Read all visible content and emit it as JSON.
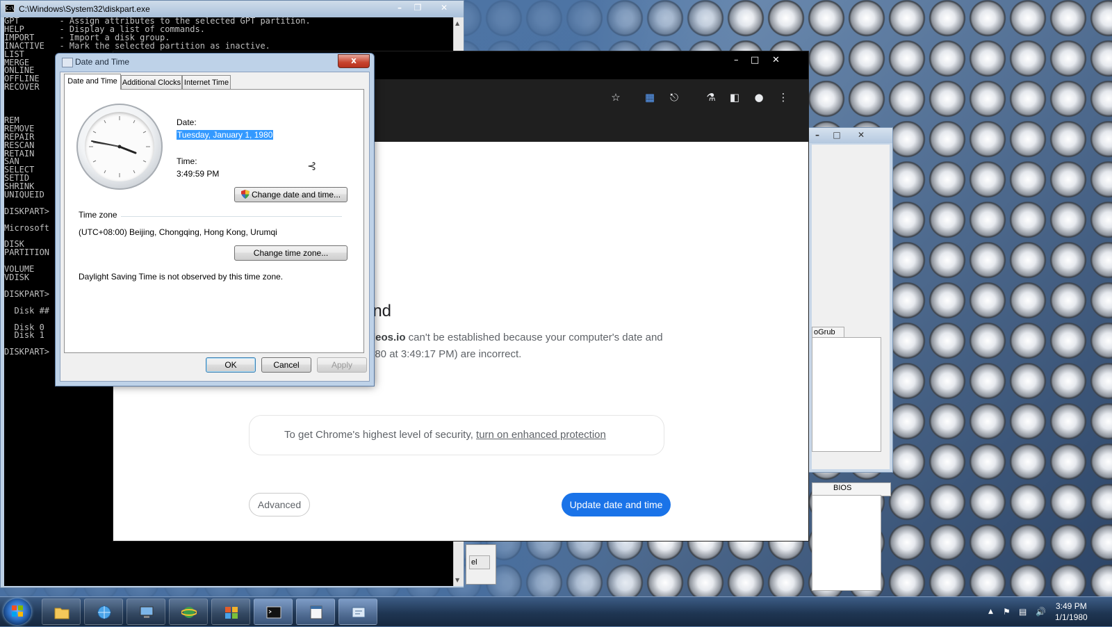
{
  "cmd": {
    "title": "C:\\Windows\\System32\\diskpart.exe",
    "lines": [
      "GPT        - Assign attributes to the selected GPT partition.",
      "HELP       - Display a list of commands.",
      "IMPORT     - Import a disk group.",
      "INACTIVE   - Mark the selected partition as inactive.",
      "LIST",
      "MERGE",
      "ONLINE",
      "OFFLINE",
      "RECOVER",
      "",
      "",
      "",
      "REM",
      "REMOVE",
      "REPAIR",
      "RESCAN",
      "RETAIN",
      "SAN",
      "SELECT",
      "SETID",
      "SHRINK",
      "UNIQUEID",
      "",
      "DISKPART>",
      "",
      "Microsoft",
      "",
      "DISK",
      "PARTITION",
      "",
      "VOLUME",
      "VDISK",
      "",
      "DISKPART>",
      "",
      "  Disk ##",
      "",
      "  Disk 0",
      "  Disk 1",
      "",
      "DISKPART>"
    ]
  },
  "ghost_window": {
    "tab1_label": "oGrub",
    "tab2_label": "BIOS"
  },
  "chrome": {
    "title_partial": "ind",
    "body_bold": "deos.io",
    "body_line1": " can't be established because your computer's date and",
    "body_line2": "980 at 3:49:17 PM) are incorrect.",
    "promo_text": "To get Chrome's highest level of security, ",
    "promo_link": "turn on enhanced protection",
    "advanced_label": "Advanced",
    "update_label": "Update date and time"
  },
  "fragment_button": "el",
  "dialog": {
    "title": "Date and Time",
    "close_label": "x",
    "tabs": [
      "Date and Time",
      "Additional Clocks",
      "Internet Time"
    ],
    "date_label": "Date:",
    "date_value": "Tuesday, January 1, 1980",
    "time_label": "Time:",
    "time_value": "3:49:59 PM",
    "change_datetime_label": "Change date and time...",
    "timezone_label": "Time zone",
    "timezone_value": "(UTC+08:00) Beijing, Chongqing, Hong Kong, Urumqi",
    "change_timezone_label": "Change time zone...",
    "dst_note": "Daylight Saving Time is not observed by this time zone.",
    "ok_label": "OK",
    "cancel_label": "Cancel",
    "apply_label": "Apply"
  },
  "taskbar": {
    "clock_time": "3:49 PM",
    "clock_date": "1/1/1980",
    "items": [
      "file-explorer",
      "network-globe",
      "computer",
      "ie-browser",
      "office",
      "cmd",
      "notepad",
      "control-panel"
    ]
  }
}
